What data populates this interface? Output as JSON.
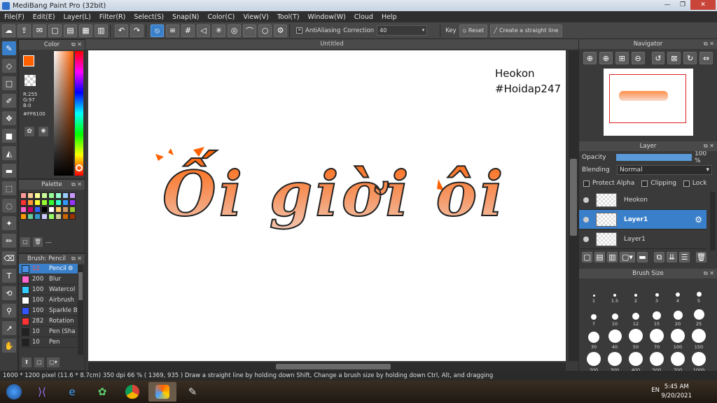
{
  "window": {
    "title": "MediBang Paint Pro (32bit)"
  },
  "menu": [
    "File(F)",
    "Edit(E)",
    "Layer(L)",
    "Filter(R)",
    "Select(S)",
    "Snap(N)",
    "Color(C)",
    "View(V)",
    "Tool(T)",
    "Window(W)",
    "Cloud",
    "Help"
  ],
  "toolbar": {
    "antialiasing_label": "AntiAliasing",
    "correction_label": "Correction",
    "correction_value": "40",
    "key_label": "Key",
    "reset_label": "Reset",
    "straight_line_label": "Create a straight line"
  },
  "canvas": {
    "tab_title": "Untitled",
    "watermark_line1": "Heokon",
    "watermark_line2": "#Hoidap247",
    "artwork_text": "Ối giời ôi",
    "accent_color": "#ff6100"
  },
  "color_panel": {
    "title": "Color",
    "r": "R:255",
    "g": "G:97",
    "b": "B:0",
    "hex": "#FF6100",
    "foreground": "#ff6100"
  },
  "palette_panel": {
    "title": "Palette",
    "footer": "---",
    "swatches": [
      "#ff9999",
      "#ffcc99",
      "#ffff99",
      "#ccff99",
      "#99ff99",
      "#99ffcc",
      "#99ccff",
      "#cc99ff",
      "#ff3333",
      "#ff9933",
      "#ffff33",
      "#99ff33",
      "#33ff33",
      "#33ffcc",
      "#3399ff",
      "#9933ff",
      "#ff66cc",
      "#cc0066",
      "#3366ff",
      "#000000",
      "#ffffff",
      "#ffcc66",
      "#cc9966",
      "#99cc33",
      "#ff9900",
      "#66cc99",
      "#3399cc",
      "#ccccff",
      "#99ff66",
      "#cccc99",
      "#cc6600",
      "#993300"
    ]
  },
  "brush_panel": {
    "title": "Brush: Pencil",
    "brushes": [
      {
        "size": "12",
        "name": "Pencil",
        "color": "#4a90e2"
      },
      {
        "size": "200",
        "name": "Blur",
        "color": "#ff66cc"
      },
      {
        "size": "100",
        "name": "Watercol",
        "color": "#33ccff"
      },
      {
        "size": "100",
        "name": "Airbrush",
        "color": "#ffffff"
      },
      {
        "size": "100",
        "name": "Sparkle B",
        "color": "#3355ff"
      },
      {
        "size": "282",
        "name": "Rotation",
        "color": "#ff3333"
      },
      {
        "size": "10",
        "name": "Pen (Sha",
        "color": "#222222"
      },
      {
        "size": "10",
        "name": "Pen",
        "color": "#222222"
      }
    ]
  },
  "navigator": {
    "title": "Navigator"
  },
  "layer_panel": {
    "title": "Layer",
    "opacity_label": "Opacity",
    "opacity_value": "100 %",
    "opacity_level": 1.0,
    "blending_label": "Blending",
    "blending_value": "Normal",
    "protect_alpha_label": "Protect Alpha",
    "clipping_label": "Clipping",
    "lock_label": "Lock",
    "layers": [
      {
        "name": "Heokon",
        "selected": false
      },
      {
        "name": "Layer1",
        "selected": true
      },
      {
        "name": "Layer1",
        "selected": false
      }
    ]
  },
  "brush_size_panel": {
    "title": "Brush Size",
    "sizes": [
      "1",
      "1.5",
      "2",
      "3",
      "4",
      "5",
      "7",
      "10",
      "12",
      "15",
      "20",
      "25",
      "30",
      "40",
      "50",
      "70",
      "100",
      "150",
      "200",
      "300",
      "400",
      "500",
      "700",
      "1000"
    ]
  },
  "status": {
    "text": "1600 * 1200 pixel  (11.6 * 8.7cm)  350 dpi  66 %  ( 1369, 935 )  Draw a straight line by holding down Shift, Change a brush size by holding down Ctrl, Alt, and dragging"
  },
  "taskbar": {
    "lang": "EN",
    "time": "5:45 AM",
    "date": "9/20/2021"
  }
}
